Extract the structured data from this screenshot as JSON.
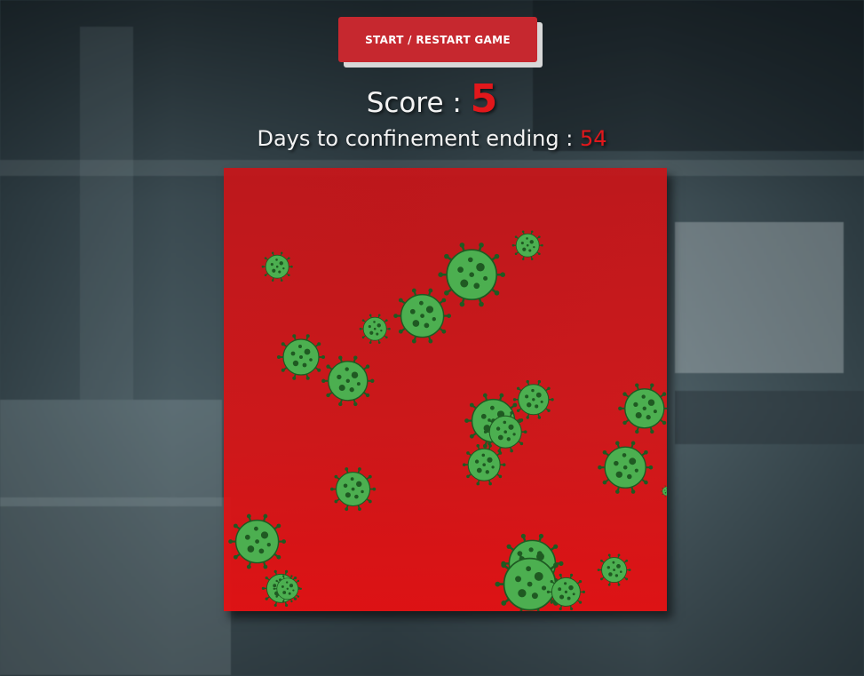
{
  "game": {
    "start_button_label": "START / RESTART GAME",
    "score_label": "Score : ",
    "score_value": "5",
    "days_label": "Days to confinement ending : ",
    "days_value": "54"
  },
  "colors": {
    "accent": "#e1171b",
    "button": "#c6282f",
    "virus_body": "#4caf50",
    "virus_spots": "#1f5a22"
  },
  "icons": {
    "enemy": "coronavirus-icon"
  }
}
